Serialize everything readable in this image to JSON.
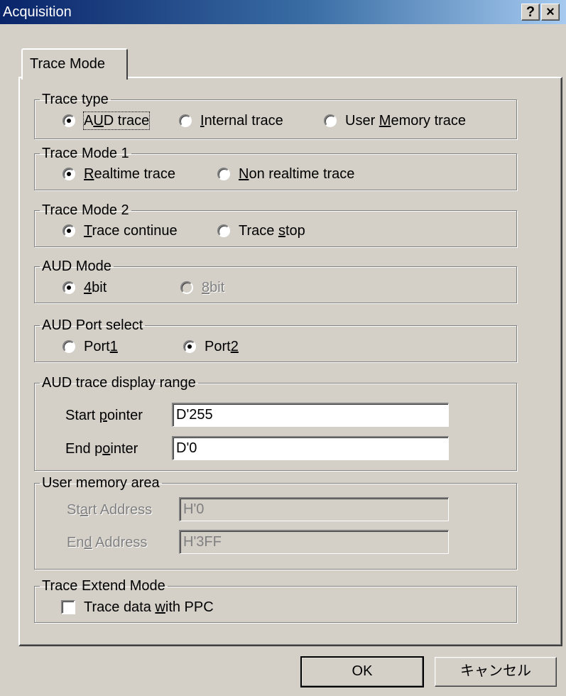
{
  "window": {
    "title": "Acquisition",
    "help_button": "?",
    "close_button": "×"
  },
  "tab": {
    "label": "Trace Mode"
  },
  "trace_type": {
    "legend": "Trace type",
    "options": [
      {
        "label": "AUD trace",
        "checked": true
      },
      {
        "label": "Internal trace",
        "checked": false
      },
      {
        "label": "User Memory trace",
        "checked": false
      }
    ]
  },
  "trace_mode_1": {
    "legend": "Trace Mode 1",
    "options": [
      {
        "label": "Realtime trace",
        "checked": true
      },
      {
        "label": "Non realtime trace",
        "checked": false
      }
    ]
  },
  "trace_mode_2": {
    "legend": "Trace Mode 2",
    "options": [
      {
        "label": "Trace continue",
        "checked": true
      },
      {
        "label": "Trace stop",
        "checked": false
      }
    ]
  },
  "aud_mode": {
    "legend": "AUD Mode",
    "options": [
      {
        "label": "4bit",
        "checked": true,
        "enabled": true
      },
      {
        "label": "8bit",
        "checked": false,
        "enabled": false
      }
    ]
  },
  "aud_port": {
    "legend": "AUD Port select",
    "options": [
      {
        "label": "Port1",
        "checked": false
      },
      {
        "label": "Port2",
        "checked": true
      }
    ]
  },
  "display_range": {
    "legend": "AUD trace display range",
    "start_label": "Start pointer",
    "start_value": "D'255",
    "end_label": "End pointer",
    "end_value": "D'0"
  },
  "user_memory": {
    "legend": "User memory area",
    "start_label": "Start Address",
    "start_value": "H'0",
    "end_label": "End Address",
    "end_value": "H'3FF"
  },
  "extend_mode": {
    "legend": "Trace Extend Mode",
    "checkbox_label": "Trace data with PPC",
    "checked": false
  },
  "buttons": {
    "ok": "OK",
    "cancel": "キャンセル"
  }
}
